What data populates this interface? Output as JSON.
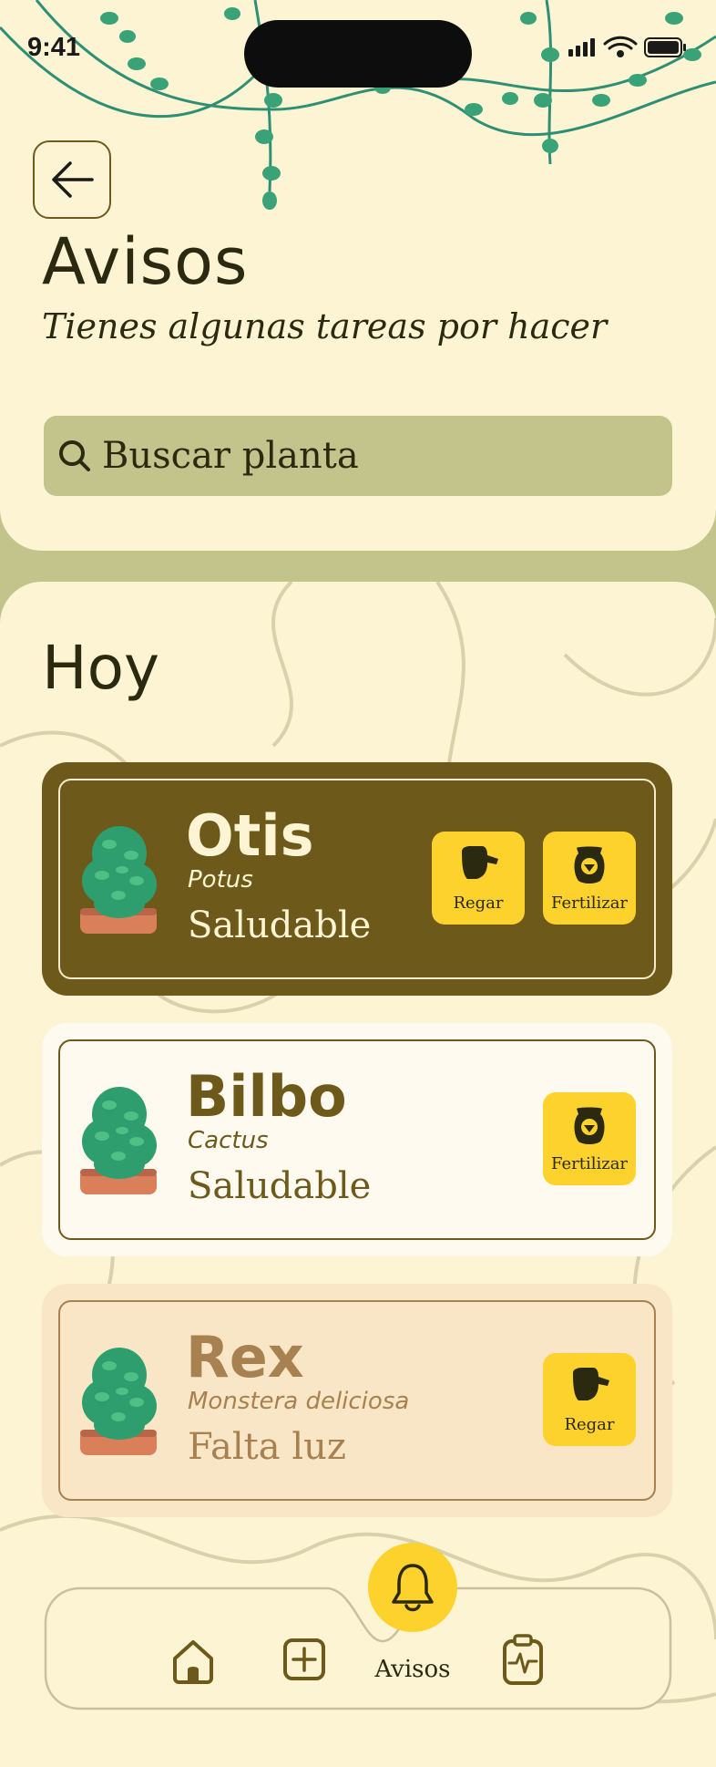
{
  "status_bar": {
    "time": "9:41"
  },
  "header": {
    "title": "Avisos",
    "subtitle": "Tienes algunas tareas por hacer"
  },
  "search": {
    "placeholder": "Buscar planta"
  },
  "section": {
    "title": "Hoy"
  },
  "cards": [
    {
      "name": "Otis",
      "species": "Potus",
      "status": "Saludable",
      "actions": [
        {
          "label": "Regar",
          "icon": "watering-can-icon"
        },
        {
          "label": "Fertilizar",
          "icon": "fertilizer-bag-icon"
        }
      ]
    },
    {
      "name": "Bilbo",
      "species": "Cactus",
      "status": "Saludable",
      "actions": [
        {
          "label": "Fertilizar",
          "icon": "fertilizer-bag-icon"
        }
      ]
    },
    {
      "name": "Rex",
      "species": "Monstera deliciosa",
      "status": "Falta luz",
      "actions": [
        {
          "label": "Regar",
          "icon": "watering-can-icon"
        }
      ]
    }
  ],
  "nav": {
    "active_label": "Avisos",
    "items": [
      "home-icon",
      "add-icon",
      "bell-icon",
      "clipboard-health-icon"
    ]
  },
  "colors": {
    "background": "#fcf4d3",
    "accent": "#fdd22c",
    "olive": "#6d5a1b",
    "sage": "#c3c48b",
    "peach": "#f9e6c7"
  }
}
